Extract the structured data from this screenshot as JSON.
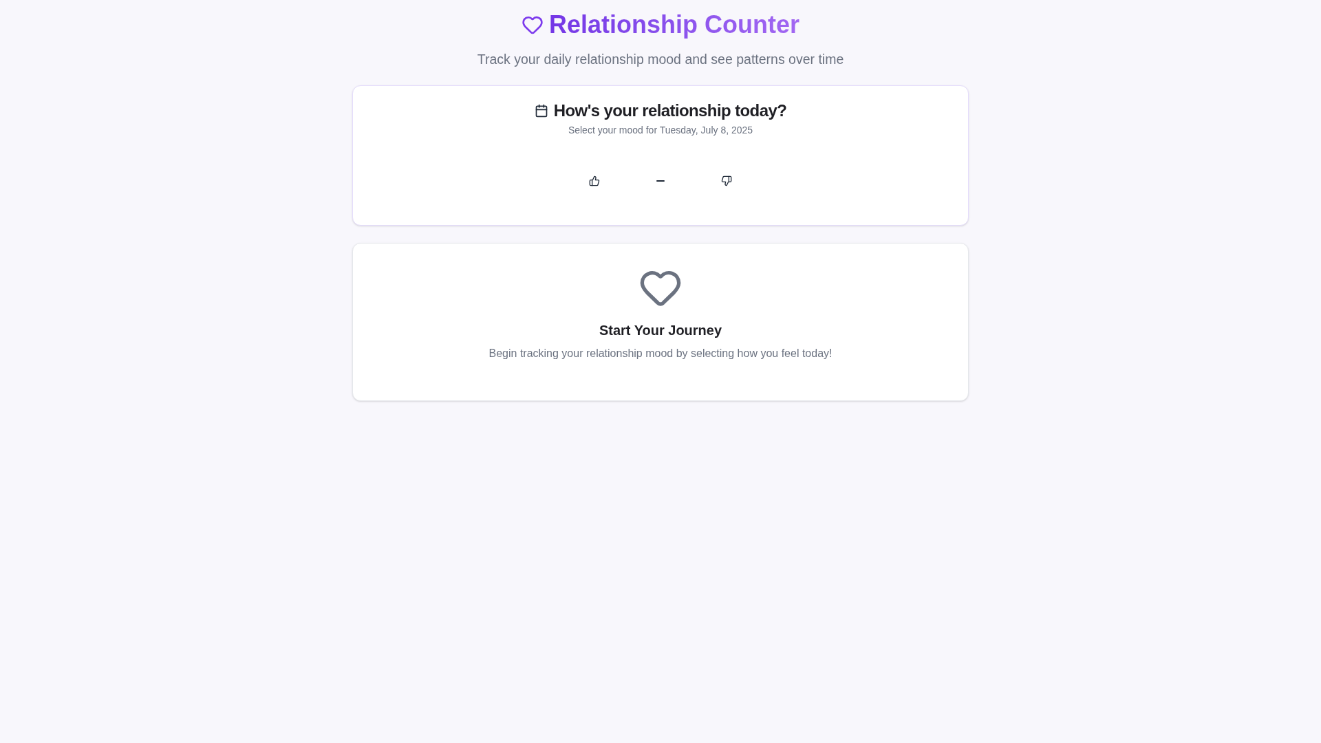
{
  "header": {
    "title": "Relationship Counter",
    "subtitle": "Track your daily relationship mood and see patterns over time"
  },
  "mood_card": {
    "title": "How's your relationship today?",
    "description": "Select your mood for Tuesday, July 8, 2025",
    "options": [
      {
        "kind": "positive",
        "selected": false
      },
      {
        "kind": "neutral",
        "selected": false
      },
      {
        "kind": "negative",
        "selected": false
      }
    ]
  },
  "empty_state": {
    "title": "Start Your Journey",
    "message": "Begin tracking your relationship mood by selecting how you feel today!"
  }
}
